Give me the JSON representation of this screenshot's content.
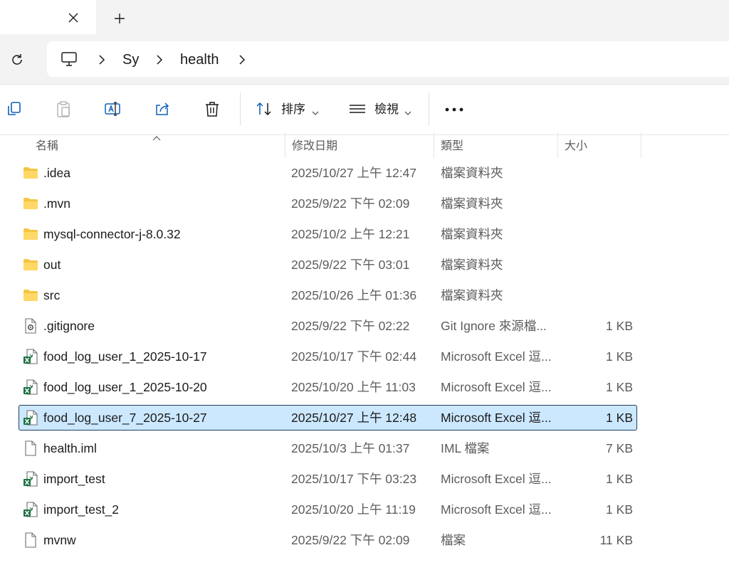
{
  "breadcrumb": [
    "Sy",
    "health"
  ],
  "toolbar": {
    "sort_label": "排序",
    "view_label": "檢視"
  },
  "columns": {
    "name": "名稱",
    "modified": "修改日期",
    "type": "類型",
    "size": "大小"
  },
  "sort_column": "name",
  "files": [
    {
      "name": ".idea",
      "date": "2025/10/27 上午 12:47",
      "type": "檔案資料夾",
      "size": "",
      "icon": "folder-icon",
      "selected": false
    },
    {
      "name": ".mvn",
      "date": "2025/9/22 下午 02:09",
      "type": "檔案資料夾",
      "size": "",
      "icon": "folder-icon",
      "selected": false
    },
    {
      "name": "mysql-connector-j-8.0.32",
      "date": "2025/10/2 上午 12:21",
      "type": "檔案資料夾",
      "size": "",
      "icon": "folder-icon",
      "selected": false
    },
    {
      "name": "out",
      "date": "2025/9/22 下午 03:01",
      "type": "檔案資料夾",
      "size": "",
      "icon": "folder-icon",
      "selected": false
    },
    {
      "name": "src",
      "date": "2025/10/26 上午 01:36",
      "type": "檔案資料夾",
      "size": "",
      "icon": "folder-icon",
      "selected": false
    },
    {
      "name": ".gitignore",
      "date": "2025/9/22 下午 02:22",
      "type": "Git Ignore 來源檔...",
      "size": "1 KB",
      "icon": "config-file-icon",
      "selected": false
    },
    {
      "name": "food_log_user_1_2025-10-17",
      "date": "2025/10/17 下午 02:44",
      "type": "Microsoft Excel 逗...",
      "size": "1 KB",
      "icon": "excel-file-icon",
      "selected": false
    },
    {
      "name": "food_log_user_1_2025-10-20",
      "date": "2025/10/20 上午 11:03",
      "type": "Microsoft Excel 逗...",
      "size": "1 KB",
      "icon": "excel-file-icon",
      "selected": false
    },
    {
      "name": "food_log_user_7_2025-10-27",
      "date": "2025/10/27 上午 12:48",
      "type": "Microsoft Excel 逗...",
      "size": "1 KB",
      "icon": "excel-file-icon",
      "selected": true
    },
    {
      "name": "health.iml",
      "date": "2025/10/3 上午 01:37",
      "type": "IML 檔案",
      "size": "7 KB",
      "icon": "file-icon",
      "selected": false
    },
    {
      "name": "import_test",
      "date": "2025/10/17 下午 03:23",
      "type": "Microsoft Excel 逗...",
      "size": "1 KB",
      "icon": "excel-file-icon",
      "selected": false
    },
    {
      "name": "import_test_2",
      "date": "2025/10/20 上午 11:19",
      "type": "Microsoft Excel 逗...",
      "size": "1 KB",
      "icon": "excel-file-icon",
      "selected": false
    },
    {
      "name": "mvnw",
      "date": "2025/9/22 下午 02:09",
      "type": "檔案",
      "size": "11 KB",
      "icon": "file-icon",
      "selected": false
    }
  ],
  "colors": {
    "selection_bg": "#cce8ff",
    "folder": "#f4c542",
    "excel": "#1d7044"
  }
}
